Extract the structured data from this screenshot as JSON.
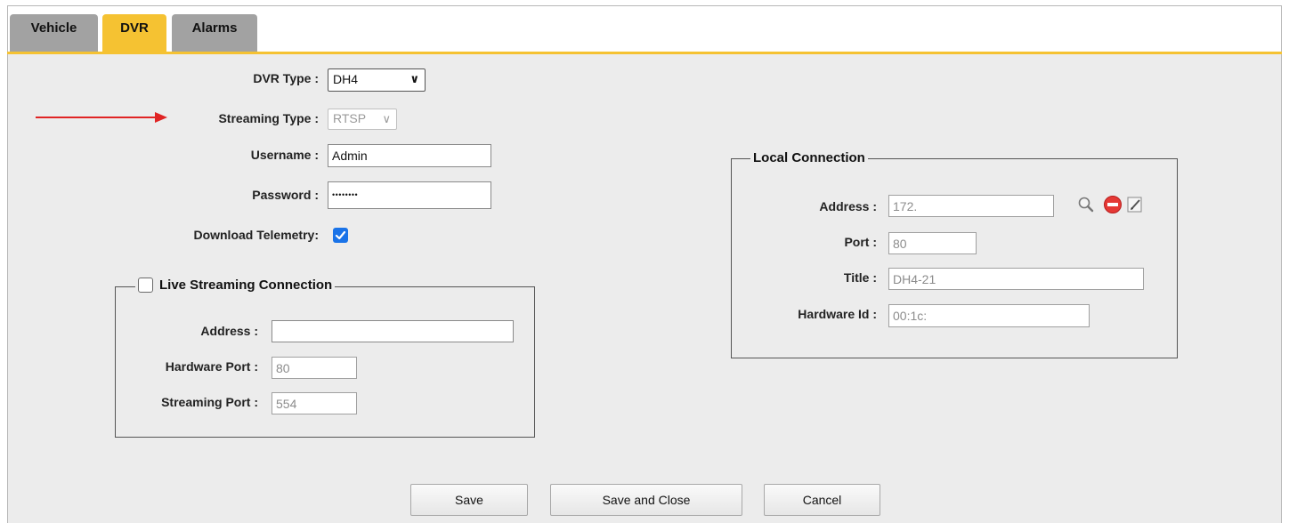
{
  "tabs": [
    {
      "label": "Vehicle",
      "active": false
    },
    {
      "label": "DVR",
      "active": true
    },
    {
      "label": "Alarms",
      "active": false
    }
  ],
  "colors": {
    "accent": "#f5c232",
    "tab_inactive": "#a2a2a2",
    "panel_bg": "#ececec",
    "checkbox_on": "#1a73e8",
    "arrow": "#e02424",
    "delete_icon": "#e53935"
  },
  "dvr": {
    "dvr_type_label": "DVR Type :",
    "dvr_type_value": "DH4",
    "streaming_type_label": "Streaming Type :",
    "streaming_type_value": "RTSP",
    "username_label": "Username :",
    "username_value": "Admin",
    "password_label": "Password :",
    "password_value": "••••••••",
    "download_telemetry_label": "Download Telemetry:",
    "download_telemetry_checked": true
  },
  "live_streaming": {
    "legend": "Live Streaming Connection",
    "enabled": false,
    "address_label": "Address :",
    "address_value": "",
    "hardware_port_label": "Hardware Port :",
    "hardware_port_value": "80",
    "streaming_port_label": "Streaming Port :",
    "streaming_port_value": "554"
  },
  "local_connection": {
    "legend": "Local Connection",
    "address_label": "Address :",
    "address_value": "172.",
    "port_label": "Port :",
    "port_value": "80",
    "title_label": "Title :",
    "title_value": "DH4-21",
    "hardware_id_label": "Hardware Id :",
    "hardware_id_value": "00:1c:",
    "icons": [
      "search-icon",
      "delete-icon",
      "edit-icon"
    ]
  },
  "buttons": {
    "save": "Save",
    "save_and_close": "Save and Close",
    "cancel": "Cancel"
  }
}
